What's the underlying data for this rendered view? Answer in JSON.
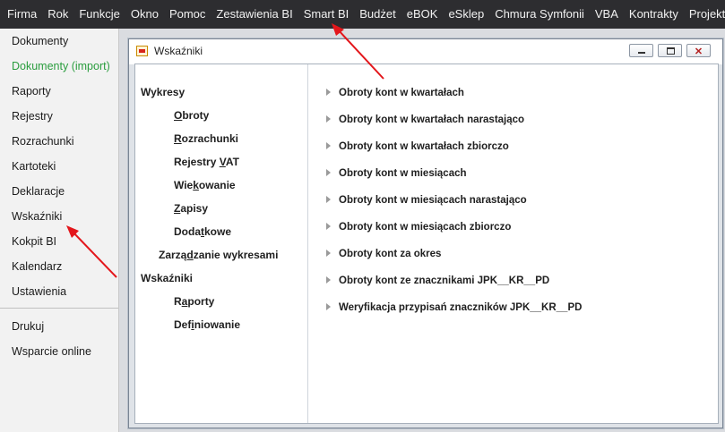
{
  "menubar": {
    "items": [
      "Firma",
      "Rok",
      "Funkcje",
      "Okno",
      "Pomoc",
      "Zestawienia BI",
      "Smart BI",
      "Budżet",
      "eBOK",
      "eSklep",
      "Chmura Symfonii",
      "VBA",
      "Kontrakty",
      "Projekty"
    ]
  },
  "sidebar": {
    "items": [
      "Dokumenty",
      "Dokumenty (import)",
      "Raporty",
      "Rejestry",
      "Rozrachunki",
      "Kartoteki",
      "Deklaracje",
      "Wskaźniki",
      "Kokpit BI",
      "Kalendarz",
      "Ustawienia"
    ],
    "bottom_items": [
      "Drukuj",
      "Wsparcie online"
    ]
  },
  "window": {
    "title": "Wskaźniki",
    "close_glyph": "✕"
  },
  "tree": {
    "wykresy": "Wykresy",
    "obroty": {
      "pre": "",
      "u": "O",
      "post": "broty"
    },
    "rozrachunki": {
      "pre": "",
      "u": "R",
      "post": "ozrachunki"
    },
    "rejestry_vat": {
      "pre": "Rejestry ",
      "u": "V",
      "post": "AT"
    },
    "wiekowanie": {
      "pre": "Wie",
      "u": "k",
      "post": "owanie"
    },
    "zapisy": {
      "pre": "",
      "u": "Z",
      "post": "apisy"
    },
    "dodatkowe": {
      "pre": "Doda",
      "u": "t",
      "post": "kowe"
    },
    "zarzadzanie": {
      "pre": "Zarzą",
      "u": "d",
      "post": "zanie wykresami"
    },
    "wskazniki": "Wskaźniki",
    "raporty": {
      "pre": "R",
      "u": "a",
      "post": "porty"
    },
    "definiowanie": {
      "pre": "Def",
      "u": "i",
      "post": "niowanie"
    }
  },
  "reports": [
    "Obroty kont w kwartałach",
    "Obroty kont w kwartałach narastająco",
    "Obroty kont w kwartałach zbiorczo",
    "Obroty kont w miesiącach",
    "Obroty kont w miesiącach narastająco",
    "Obroty kont w miesiącach zbiorczo",
    "Obroty kont za okres",
    "Obroty kont ze znacznikami JPK__KR__PD",
    "Weryfikacja przypisań znaczników JPK__KR__PD"
  ],
  "colors": {
    "menubar_bg": "#2d2d30",
    "accent_green": "#2a9d3e",
    "annotation_arrow": "#e3161b"
  }
}
